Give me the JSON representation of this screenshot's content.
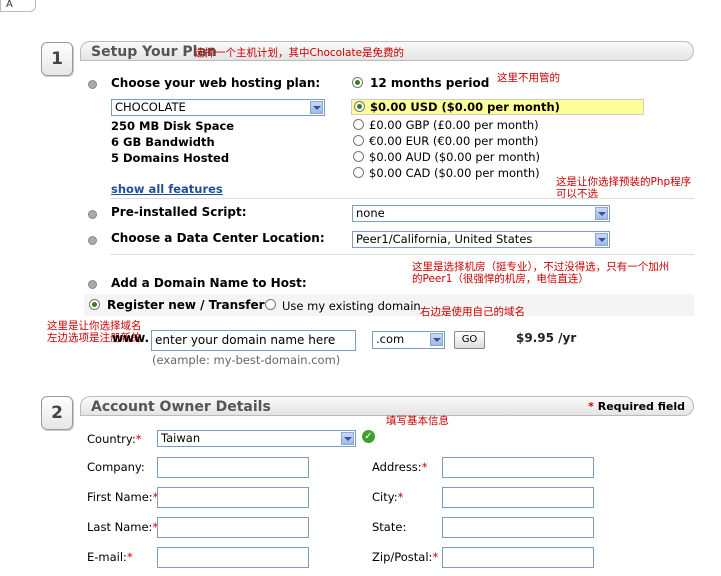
{
  "top_fragment": "A",
  "step1": {
    "number": "1",
    "title": "Setup Your Plan",
    "title_note": "选择一个主机计划，其中Chocolate是免费的",
    "plan_label": "Choose your web hosting plan:",
    "period_label": "12 months period",
    "period_note": "这里不用管的",
    "plan_select": "CHOCOLATE",
    "features": [
      "250 MB Disk Space",
      "6 GB Bandwidth",
      "5 Domains Hosted"
    ],
    "show_all": "show all features",
    "prices": [
      {
        "label": "$0.00 USD ($0.00 per month)",
        "selected": true
      },
      {
        "label": "£0.00 GBP (£0.00 per month)",
        "selected": false
      },
      {
        "label": "€0.00 EUR (€0.00 per month)",
        "selected": false
      },
      {
        "label": "$0.00 AUD ($0.00 per month)",
        "selected": false
      },
      {
        "label": "$0.00 CAD ($0.00 per month)",
        "selected": false
      }
    ],
    "script_note_line1": "这是让你选择预装的Php程序",
    "script_note_line2": "可以不选",
    "script_label": "Pre-installed Script:",
    "script_select": "none",
    "datacenter_label": "Choose a Data Center Location:",
    "datacenter_select": "Peer1/California, United States",
    "datacenter_note_line1": "这里是选择机房（挺专业），不过没得选，只有一个加州",
    "datacenter_note_line2": "的Peer1（很强悍的机房，电信直连）",
    "domain_label": "Add a Domain Name to Host:",
    "register_label": "Register new / Transfer",
    "existing_label": "Use my existing domain",
    "existing_note": "右边是使用自己的域名",
    "left_note_line1": "这里是让你选择域名",
    "left_note_line2": "左边选项是注册新的",
    "www_label": "www.",
    "domain_input_value": "enter your domain name here",
    "domain_example": "(example: my-best-domain.com)",
    "tld_select": ".com",
    "go_button": "GO",
    "price": "$9.95 /yr"
  },
  "step2": {
    "number": "2",
    "title": "Account Owner Details",
    "required_star": "*",
    "required_text": "Required field",
    "basic_note": "填写基本信息",
    "country_label": "Country:",
    "country_value": "Taiwan",
    "company_label": "Company:",
    "address_label": "Address:",
    "first_name_label": "First Name:",
    "city_label": "City:",
    "last_name_label": "Last Name:",
    "state_label": "State:",
    "email_label": "E-mail:",
    "zip_label": "Zip/Postal:",
    "star": "*"
  }
}
